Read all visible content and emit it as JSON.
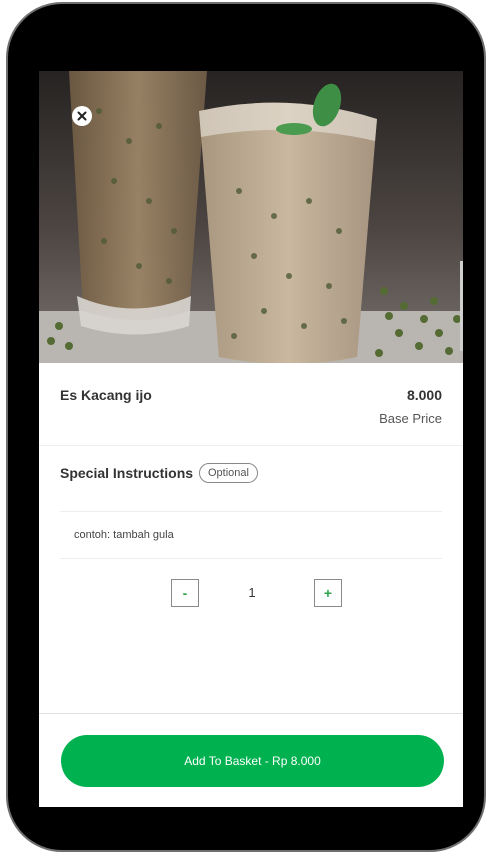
{
  "item": {
    "name": "Es Kacang ijo",
    "price": "8.000",
    "price_label": "Base Price"
  },
  "instructions": {
    "title": "Special Instructions",
    "badge": "Optional",
    "placeholder": "contoh: tambah gula"
  },
  "quantity": {
    "decrement_label": "-",
    "value": "1",
    "increment_label": "+"
  },
  "footer": {
    "add_button_label": "Add To Basket - Rp 8.000"
  },
  "colors": {
    "accent": "#00b14f",
    "stepper_icon": "#2ea44f"
  },
  "icons": {
    "close": "close-icon"
  }
}
